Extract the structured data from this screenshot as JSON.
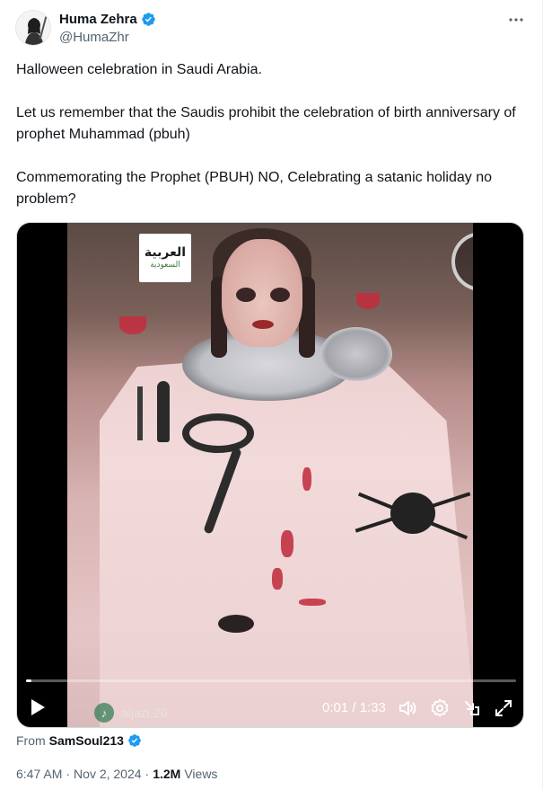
{
  "author": {
    "display_name": "Huma Zehra",
    "handle": "@HumaZhr",
    "verified_icon": "verified-badge-icon"
  },
  "more_icon": "more-horizontal-icon",
  "tweet": {
    "paragraphs": [
      "Halloween celebration in Saudi Arabia.",
      "Let us remember that the Saudis prohibit the celebration of birth anniversary of prophet Muhammad (pbuh)",
      "Commemorating the Prophet (PBUH) NO, Celebrating a satanic holiday no problem?"
    ]
  },
  "video": {
    "logo_main": "العربية",
    "logo_sub": "السعودية",
    "watermark": "aljazi.20",
    "time": "0:01 / 1:33",
    "progress": 0.011,
    "icons": [
      "play-icon",
      "volume-icon",
      "settings-icon",
      "popout-icon",
      "fullscreen-icon"
    ]
  },
  "source": {
    "from_label": "From",
    "account": "SamSoul213"
  },
  "meta": {
    "time": "6:47 AM",
    "separator": "·",
    "date": "Nov 2, 2024",
    "views_count": "1.2M",
    "views_label": "Views"
  },
  "colors": {
    "verified": "#1d9bf0",
    "text": "#0f1419",
    "muted": "#536471"
  }
}
